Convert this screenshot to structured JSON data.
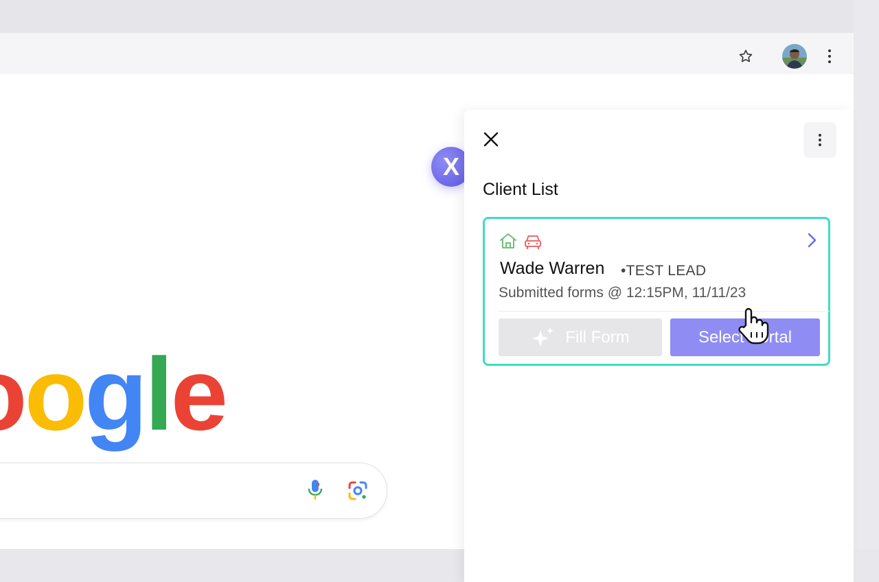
{
  "browser": {
    "toolbar_icons": [
      "star-icon",
      "avatar",
      "more-vert-icon"
    ]
  },
  "google": {
    "logo_letters": [
      {
        "char": "o",
        "color": "#ea4335"
      },
      {
        "char": "o",
        "color": "#fbbc05"
      },
      {
        "char": "o",
        "color": "#ea4335"
      },
      {
        "char": "g",
        "color": "#4285f4"
      },
      {
        "char": "l",
        "color": "#34a853"
      },
      {
        "char": "e",
        "color": "#ea4335"
      }
    ],
    "logo_visible_text": "oogle",
    "search_icons": [
      "microphone-icon",
      "google-lens-icon"
    ]
  },
  "extension": {
    "bubble_letter": "X",
    "accent": "#8f8cf3"
  },
  "panel": {
    "title": "Client List",
    "clients": [
      {
        "name": "Wade Warren",
        "tag": "•TEST LEAD",
        "submitted": "Submitted forms @ 12:15PM, 11/11/23",
        "icons": [
          "home-icon",
          "car-icon"
        ],
        "fill_form_label": "Fill Form",
        "select_portal_label": "Select Portal"
      }
    ]
  },
  "colors": {
    "card_border": "#3fdcc2",
    "primary_button": "#8f8cf3",
    "disabled_button": "#e6e6e9",
    "home_icon": "#6cc07a",
    "car_icon": "#e86b6b"
  }
}
